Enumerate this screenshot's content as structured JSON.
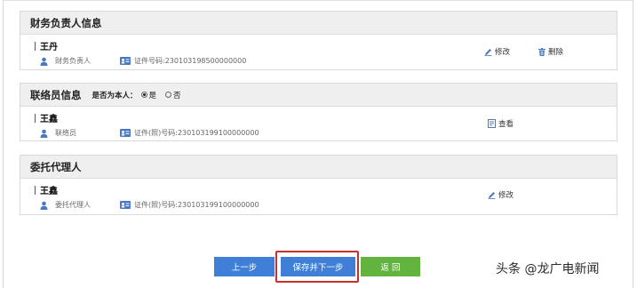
{
  "sections": {
    "finance": {
      "title": "财务负责人信息",
      "name": "王丹",
      "role": "财务负责人",
      "id_label": "证件号码:",
      "id_number": "230103198500000000",
      "edit_label": "修改",
      "delete_label": "删除"
    },
    "liaison": {
      "title": "联络员信息",
      "question": "是否为本人：",
      "option_yes": "是",
      "option_no": "否",
      "selected": "是",
      "name": "王鑫",
      "role": "联络员",
      "id_label": "证件(照)号码:",
      "id_number": "230103199100000000",
      "view_label": "查看"
    },
    "agent": {
      "title": "委托代理人",
      "name": "王鑫",
      "role": "委托代理人",
      "id_label": "证件(照)号码:",
      "id_number": "230103199100000000",
      "edit_label": "修改"
    }
  },
  "buttons": {
    "prev": "上一步",
    "save_next": "保存并下一步",
    "back": "返 回"
  },
  "watermark": "头条 @龙广电新闻",
  "colors": {
    "primary": "#3f7fd7",
    "success": "#63b43f",
    "highlight_border": "#c9302c",
    "icon": "#4a78c2"
  }
}
